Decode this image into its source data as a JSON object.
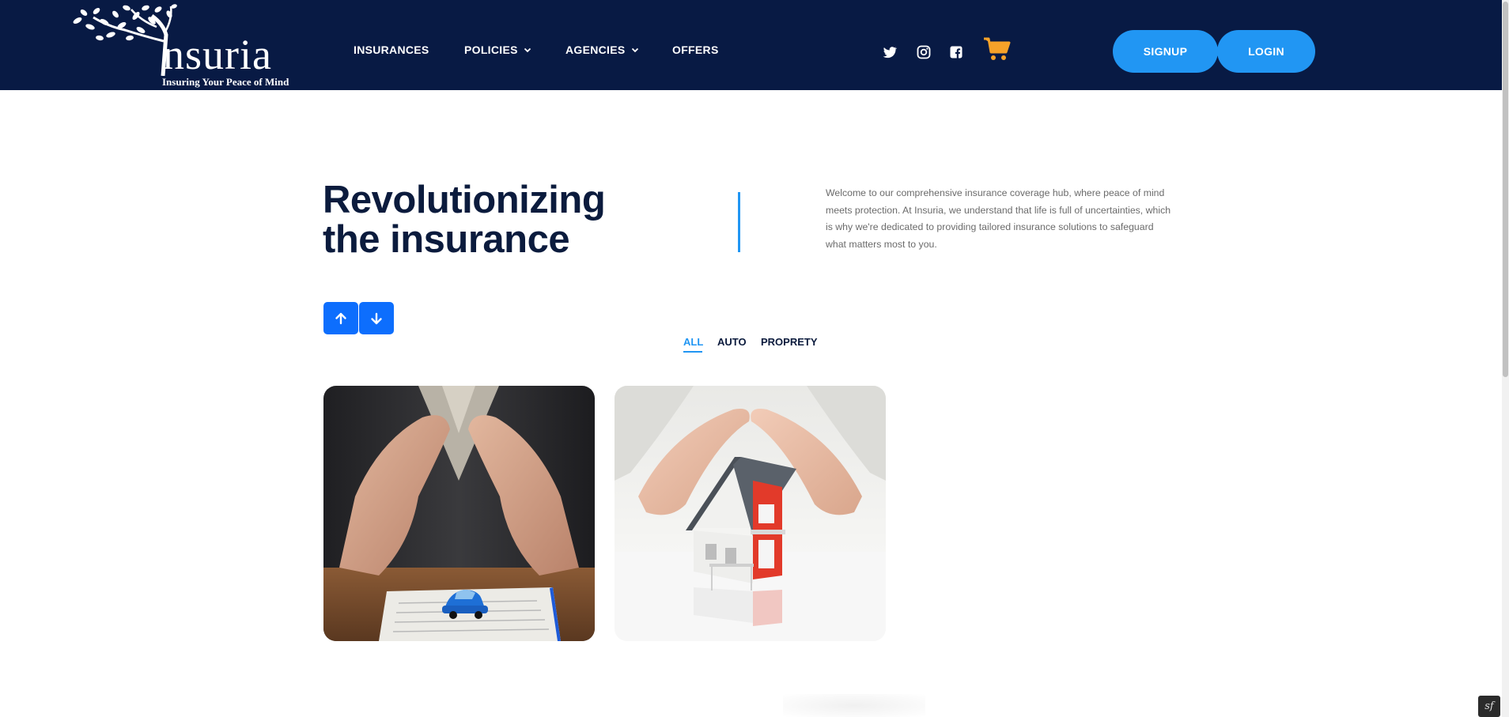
{
  "brand": {
    "name": "nsuria",
    "tagline": "Insuring Your Peace of Mind",
    "logo_icon": "tree-letter-i-logo"
  },
  "nav": {
    "items": [
      {
        "label": "INSURANCES",
        "dropdown": false
      },
      {
        "label": "POLICIES",
        "dropdown": true
      },
      {
        "label": "AGENCIES",
        "dropdown": true
      },
      {
        "label": "OFFERS",
        "dropdown": false
      }
    ]
  },
  "social": {
    "icons": [
      "twitter-icon",
      "instagram-icon",
      "facebook-icon"
    ],
    "cart_icon": "shopping-cart-icon"
  },
  "auth": {
    "signup_label": "SIGNUP",
    "login_label": "LOGIN"
  },
  "hero": {
    "title_line1": "Revolutionizing",
    "title_line2": "the insurance",
    "description": "Welcome to our comprehensive insurance coverage hub, where peace of mind meets protection. At Insuria, we understand that life is full of uncertainties, which is why we're dedicated to providing tailored insurance solutions to safeguard what matters most to you."
  },
  "slider_controls": {
    "up_icon": "arrow-up-icon",
    "down_icon": "arrow-down-icon"
  },
  "filter_tabs": {
    "items": [
      "ALL",
      "AUTO",
      "PROPRETY"
    ],
    "active": "ALL"
  },
  "cards": [
    {
      "subject": "hands-protecting-car"
    },
    {
      "subject": "hands-protecting-house"
    }
  ],
  "colors": {
    "header_bg": "#081a44",
    "accent": "#2196f3",
    "button_blue": "#0d6efd",
    "cart_orange": "#f6a229",
    "title_text": "#0b1b3d"
  }
}
